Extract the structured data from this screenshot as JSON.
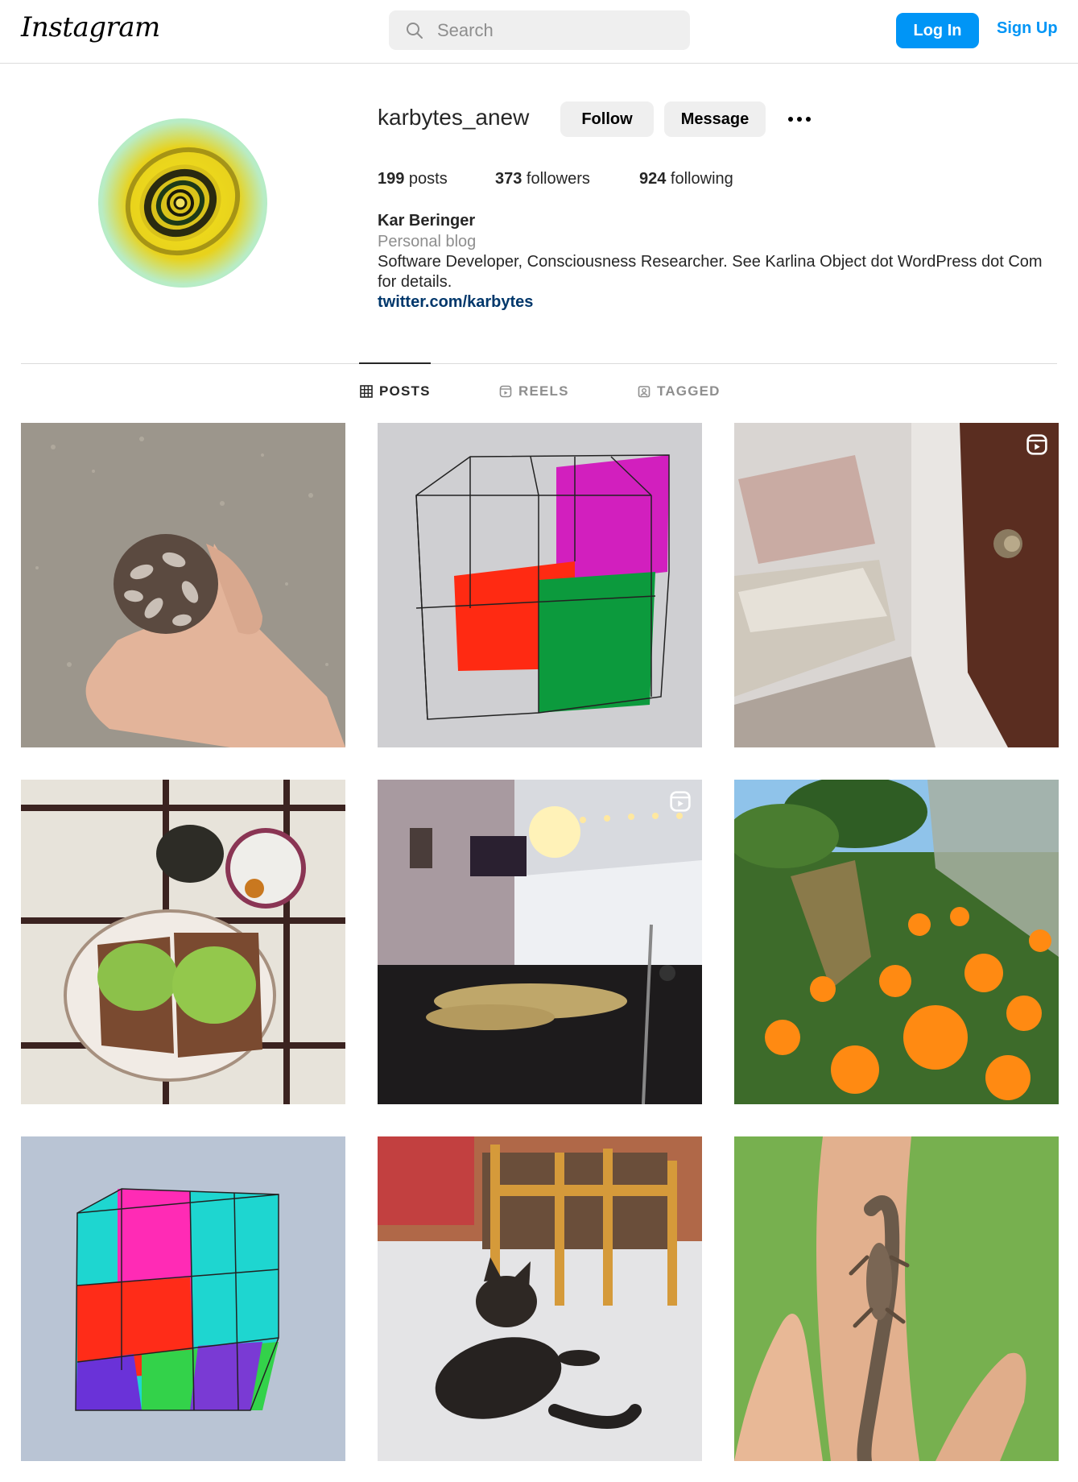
{
  "header": {
    "logo": "Instagram",
    "search_placeholder": "Search",
    "login_label": "Log In",
    "signup_label": "Sign Up",
    "icons": [
      "search-icon"
    ]
  },
  "profile": {
    "username": "karbytes_anew",
    "follow_label": "Follow",
    "message_label": "Message",
    "posts_count": "199",
    "posts_label": " posts",
    "followers_count": "373",
    "followers_label": " followers",
    "following_count": "924",
    "following_label": " following",
    "full_name": "Kar Beringer",
    "category": "Personal blog",
    "bio": "Software Developer, Consciousness Researcher. See Karlina Object dot WordPress dot Com for details.",
    "link": "twitter.com/karbytes"
  },
  "tabs": [
    {
      "label": "POSTS",
      "icon": "grid-icon",
      "active": true
    },
    {
      "label": "REELS",
      "icon": "reels-icon",
      "active": false
    },
    {
      "label": "TAGGED",
      "icon": "tagged-icon",
      "active": false
    }
  ],
  "posts": [
    {
      "subject": "pinecone-in-hand",
      "reel": false
    },
    {
      "subject": "cube-drawing-magenta-red-green",
      "reel": false
    },
    {
      "subject": "bed-and-door",
      "reel": true
    },
    {
      "subject": "avocado-toast",
      "reel": false
    },
    {
      "subject": "drum-kit-room",
      "reel": true
    },
    {
      "subject": "orange-poppies",
      "reel": false
    },
    {
      "subject": "colorful-cube-drawing",
      "reel": false
    },
    {
      "subject": "cat-on-floor",
      "reel": false
    },
    {
      "subject": "lizard-on-hand",
      "reel": false
    }
  ],
  "colors": {
    "primary_blue": "#0095f6",
    "link_blue": "#00376b",
    "secondary_text": "#8e8e8e",
    "button_gray": "#efefef",
    "divider": "#dbdbdb"
  }
}
